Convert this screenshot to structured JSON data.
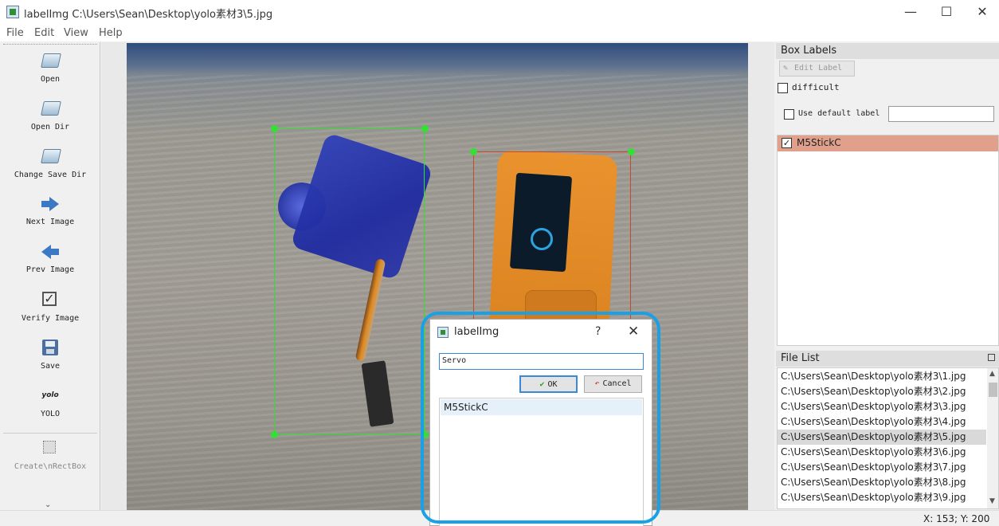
{
  "window": {
    "title": "labelImg C:\\Users\\Sean\\Desktop\\yolo素材3\\5.jpg",
    "minimize_glyph": "—",
    "maximize_glyph": "☐",
    "close_glyph": "✕"
  },
  "menu": [
    "File",
    "Edit",
    "View",
    "Help"
  ],
  "toolbar": {
    "open": "Open",
    "open_dir": "Open Dir",
    "change_save_dir": "Change Save Dir",
    "next_image": "Next Image",
    "prev_image": "Prev Image",
    "verify_image": "Verify Image",
    "save": "Save",
    "yolo_icon_text": "yolo",
    "yolo": "YOLO",
    "create_rect": "Create\\nRectBox",
    "more": "⌄"
  },
  "dialog": {
    "title": "labelImg",
    "help": "?",
    "close": "✕",
    "input_value": "Servo",
    "ok": "OK",
    "cancel": "Cancel",
    "list_items": [
      "M5StickC"
    ]
  },
  "right_panel": {
    "box_labels_title": "Box Labels",
    "edit_label": "Edit Label",
    "difficult": "difficult",
    "use_default_label": "Use default label",
    "default_label_value": "",
    "labels": [
      {
        "text": "M5StickC",
        "checked": true
      }
    ],
    "file_list_title": "File List",
    "files": [
      "C:\\Users\\Sean\\Desktop\\yolo素材3\\1.jpg",
      "C:\\Users\\Sean\\Desktop\\yolo素材3\\2.jpg",
      "C:\\Users\\Sean\\Desktop\\yolo素材3\\3.jpg",
      "C:\\Users\\Sean\\Desktop\\yolo素材3\\4.jpg",
      "C:\\Users\\Sean\\Desktop\\yolo素材3\\5.jpg",
      "C:\\Users\\Sean\\Desktop\\yolo素材3\\6.jpg",
      "C:\\Users\\Sean\\Desktop\\yolo素材3\\7.jpg",
      "C:\\Users\\Sean\\Desktop\\yolo素材3\\8.jpg",
      "C:\\Users\\Sean\\Desktop\\yolo素材3\\9.jpg"
    ],
    "selected_file_index": 4
  },
  "status": {
    "coords": "X: 153; Y: 200"
  },
  "colors": {
    "servo_box": "#2fe02f",
    "m5_box": "#c44a2a",
    "highlight": "#1aa0e6",
    "selected_label_bg": "#e0a08c"
  }
}
